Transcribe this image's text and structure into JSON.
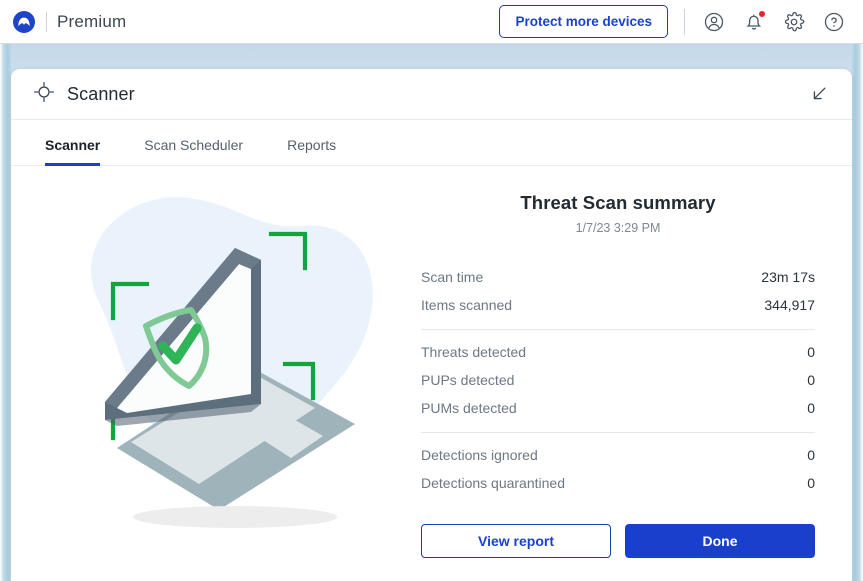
{
  "topbar": {
    "logo_icon": "malwarebytes-m-logo",
    "brand_name": "Premium",
    "protect_button": "Protect more devices",
    "icons": [
      {
        "name": "account-icon",
        "glyph": "account"
      },
      {
        "name": "notifications-bell-icon",
        "glyph": "bell",
        "has_badge": true
      },
      {
        "name": "settings-gear-icon",
        "glyph": "gear"
      },
      {
        "name": "help-icon",
        "glyph": "question"
      }
    ]
  },
  "panel": {
    "icon": "scanner-target-icon",
    "title": "Scanner",
    "collapse_icon": "arrow-down-left-icon",
    "tabs": [
      {
        "label": "Scanner",
        "active": true
      },
      {
        "label": "Scan Scheduler",
        "active": false
      },
      {
        "label": "Reports",
        "active": false
      }
    ]
  },
  "summary": {
    "title": "Threat Scan summary",
    "date": "1/7/23 3:29 PM",
    "groups": [
      {
        "rows": [
          {
            "label": "Scan time",
            "value": "23m 17s"
          },
          {
            "label": "Items scanned",
            "value": "344,917"
          }
        ]
      },
      {
        "rows": [
          {
            "label": "Threats detected",
            "value": "0"
          },
          {
            "label": "PUPs detected",
            "value": "0"
          },
          {
            "label": "PUMs detected",
            "value": "0"
          }
        ]
      },
      {
        "rows": [
          {
            "label": "Detections ignored",
            "value": "0"
          },
          {
            "label": "Detections quarantined",
            "value": "0"
          }
        ]
      }
    ],
    "view_report_button": "View report",
    "done_button": "Done"
  },
  "illustration": {
    "name": "laptop-shield-scan-illustration",
    "colors": {
      "blob": "#eaf2fb",
      "bracket_green": "#14a33c",
      "shield_green": "#7ec994",
      "check_green": "#2fb458",
      "laptop_frame": "#5d6e7d",
      "laptop_base": "#9fb4ba",
      "laptop_keyboard": "#dde5e9",
      "screen_white": "#fbfdfd",
      "shadow": "#ededed"
    }
  },
  "theme": {
    "accent_blue": "#1a3fcc",
    "text_dark": "#222a32",
    "text_muted": "#6d7884",
    "badge_red": "#e8232a",
    "page_blue": "#cfe0ee"
  }
}
